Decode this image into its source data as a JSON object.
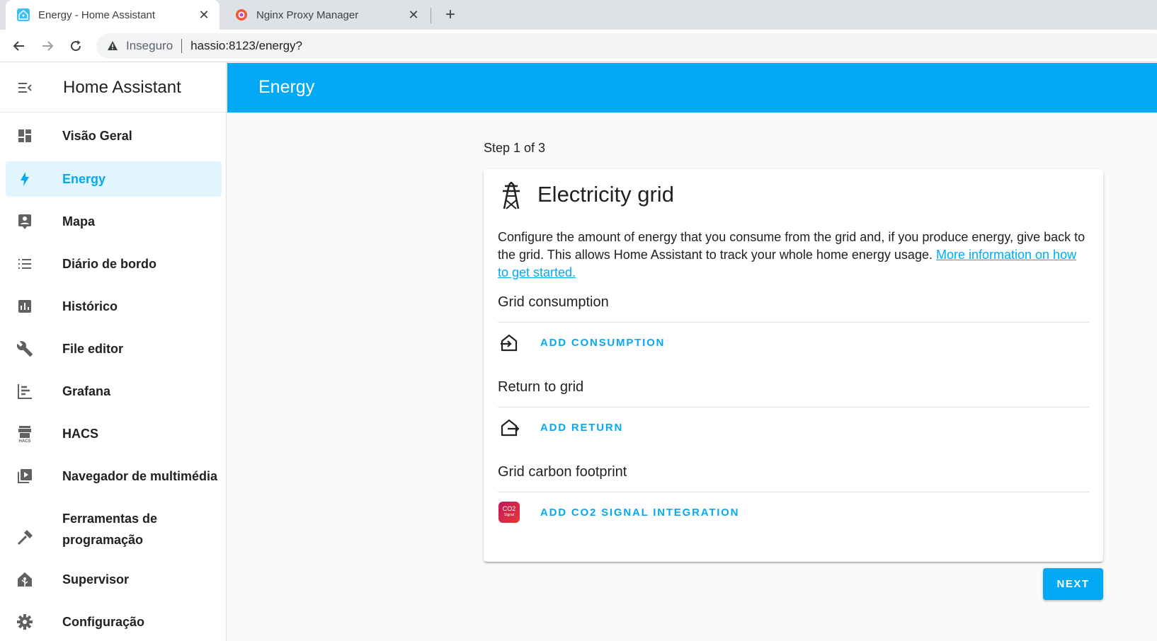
{
  "browser": {
    "tabs": [
      {
        "title": "Energy - Home Assistant",
        "active": true,
        "icon": "home-assistant-favicon"
      },
      {
        "title": "Nginx Proxy Manager",
        "active": false,
        "icon": "nginx-proxy-manager-favicon"
      }
    ],
    "address": {
      "security_label": "Inseguro",
      "url": "hassio:8123/energy?"
    }
  },
  "sidebar": {
    "title": "Home Assistant",
    "items": [
      {
        "label": "Visão Geral",
        "icon": "dashboard-icon"
      },
      {
        "label": "Energy",
        "icon": "lightning-bolt-icon",
        "selected": true
      },
      {
        "label": "Mapa",
        "icon": "map-account-icon"
      },
      {
        "label": "Diário de bordo",
        "icon": "format-list-icon"
      },
      {
        "label": "Histórico",
        "icon": "chart-box-icon"
      },
      {
        "label": "File editor",
        "icon": "wrench-icon"
      },
      {
        "label": "Grafana",
        "icon": "chart-timeline-icon"
      },
      {
        "label": "HACS",
        "icon": "hacs-store-icon"
      },
      {
        "label": "Navegador de multimédia",
        "icon": "play-box-multiple-icon"
      },
      {
        "label": "Ferramentas de programação",
        "icon": "hammer-icon"
      },
      {
        "label": "Supervisor",
        "icon": "home-assistant-icon"
      },
      {
        "label": "Configuração",
        "icon": "cog-icon"
      }
    ]
  },
  "header": {
    "title": "Energy"
  },
  "main": {
    "step_text": "Step 1 of 3",
    "card": {
      "title": "Electricity grid",
      "icon": "transmission-tower-icon",
      "description": "Configure the amount of energy that you consume from the grid and, if you produce energy, give back to the grid. This allows Home Assistant to track your whole home energy usage. ",
      "link_text": "More information on how to get started.",
      "sections": [
        {
          "title": "Grid consumption",
          "button": "ADD CONSUMPTION",
          "icon": "transmission-tower-import-icon"
        },
        {
          "title": "Return to grid",
          "button": "ADD RETURN",
          "icon": "transmission-tower-export-icon"
        },
        {
          "title": "Grid carbon footprint",
          "button": "ADD CO2 SIGNAL INTEGRATION",
          "icon": "co2-signal-logo",
          "logo_text": "CO2",
          "logo_subtext": "Signal"
        }
      ]
    },
    "next_label": "NEXT"
  },
  "colors": {
    "primary": "#03a9f4",
    "selected_bg": "#e1f5fe"
  }
}
